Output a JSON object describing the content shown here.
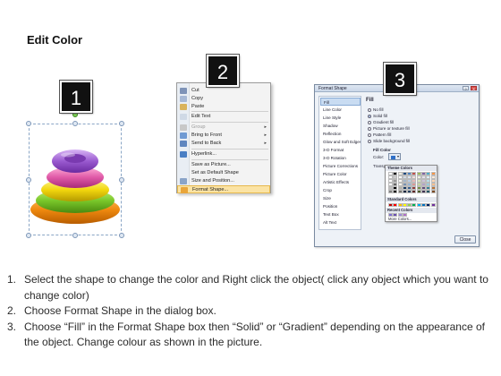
{
  "title": "Edit Color",
  "badges": [
    "1",
    "2",
    "3"
  ],
  "context_menu": {
    "items": [
      {
        "label": "Cut",
        "icon": "scissors-icon",
        "disabled": false,
        "submenu": false
      },
      {
        "label": "Copy",
        "icon": "copy-icon",
        "disabled": false,
        "submenu": false
      },
      {
        "label": "Paste",
        "icon": "paste-icon",
        "disabled": false,
        "submenu": false
      },
      {
        "label": "Edit Text",
        "icon": "edit-text-icon",
        "disabled": false,
        "submenu": false
      },
      {
        "label": "Group",
        "icon": "group-icon",
        "disabled": true,
        "submenu": true
      },
      {
        "label": "Bring to Front",
        "icon": "bring-front-icon",
        "disabled": false,
        "submenu": true
      },
      {
        "label": "Send to Back",
        "icon": "send-back-icon",
        "disabled": false,
        "submenu": true
      },
      {
        "label": "Hyperlink...",
        "icon": "hyperlink-icon",
        "disabled": false,
        "submenu": false
      },
      {
        "label": "Save as Picture...",
        "icon": "",
        "disabled": false,
        "submenu": false
      },
      {
        "label": "Set as Default Shape",
        "icon": "",
        "disabled": false,
        "submenu": false
      },
      {
        "label": "Size and Position...",
        "icon": "size-icon",
        "disabled": false,
        "submenu": false
      },
      {
        "label": "Format Shape...",
        "icon": "format-shape-icon",
        "disabled": false,
        "submenu": false,
        "active": true
      }
    ]
  },
  "format_dialog": {
    "title": "Format Shape",
    "nav": [
      "Fill",
      "Line Color",
      "Line Style",
      "Shadow",
      "Reflection",
      "Glow and Soft Edges",
      "3-D Format",
      "3-D Rotation",
      "Picture Corrections",
      "Picture Color",
      "Artistic Effects",
      "Crop",
      "Size",
      "Position",
      "Text Box",
      "Alt Text"
    ],
    "fill_heading": "Fill",
    "options": [
      "No fill",
      "Solid fill",
      "Gradient fill",
      "Picture or texture fill",
      "Pattern fill",
      "Slide background fill"
    ],
    "selected_option": "Solid fill",
    "fill_color_label": "Fill Color",
    "color_label": "Color:",
    "transparency_label": "Transpa",
    "theme_colors_label": "Theme Colors",
    "standard_colors_label": "Standard Colors",
    "recent_colors_label": "Recent Colors",
    "more_colors_label": "More Colors...",
    "close_label": "Close",
    "theme_colors": [
      "#ffffff",
      "#000000",
      "#eeece1",
      "#1f497d",
      "#4f81bd",
      "#c0504d",
      "#9bbb59",
      "#8064a2",
      "#4bacc6",
      "#f79646"
    ],
    "standard_colors": [
      "#c00000",
      "#ff0000",
      "#ffc000",
      "#ffff00",
      "#92d050",
      "#00b050",
      "#00b0f0",
      "#0070c0",
      "#002060",
      "#7030a0"
    ],
    "recent_colors": [
      "#7e6fd1",
      "#6a4fb0",
      "#9b8ad9",
      "#b070c8"
    ]
  },
  "instructions": [
    {
      "n": "1.",
      "text": "Select the shape to change the color and Right click the object( click any object which you want to change color)"
    },
    {
      "n": "2.",
      "text": "Choose Format Shape in the dialog box."
    },
    {
      "n": "3.",
      "text": "Choose “Fill” in the Format Shape box then “Solid” or “Gradient” depending on the appearance of the object. Change colour as shown in the picture."
    }
  ]
}
